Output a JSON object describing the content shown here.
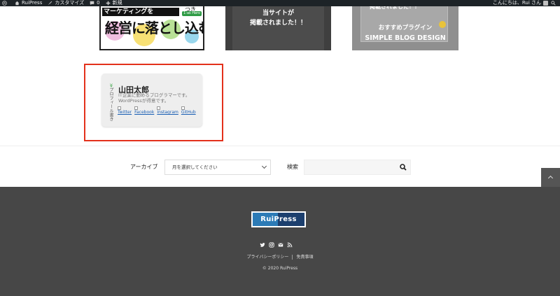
{
  "adminbar": {
    "site_name": "RuiPress",
    "customize": "カスタマイズ",
    "comments_count": "0",
    "new": "新規",
    "greeting": "こんにちは、Rui さん"
  },
  "cards": {
    "card1": {
      "title": "マーケティングを",
      "tag": "1-as Hero",
      "small": "つき",
      "big": "経営に落とし込む"
    },
    "card2": {
      "line1": "当サイトが",
      "line2": "掲載されました！！"
    },
    "card3": {
      "top": "掲載されました！！",
      "sub": "おすすめプラグイン",
      "main": "SIMPLE BLOG DESIGN"
    }
  },
  "profile": {
    "vertical_label": "プロフィール書き",
    "name": "山田太郎",
    "description": "IT企業に勤めるプログラマーです。WordPressが得意です。",
    "links": [
      "Twitter",
      "Facebook",
      "Instagram",
      "GitHub"
    ]
  },
  "widgets": {
    "archive_label": "アーカイブ",
    "archive_select": "月を選択してください",
    "search_label": "検索",
    "search_placeholder": ""
  },
  "footer": {
    "logo": "RuiPress",
    "links": [
      "プライバシーポリシー",
      "免責事項"
    ],
    "copyright": "© 2020 RuiPress"
  },
  "colors": {
    "adminbar": "#1d2327",
    "highlight": "#e3311b",
    "footer": "#474747",
    "logo_left": "#2c7bb6",
    "logo_right": "#1c3f6e"
  }
}
